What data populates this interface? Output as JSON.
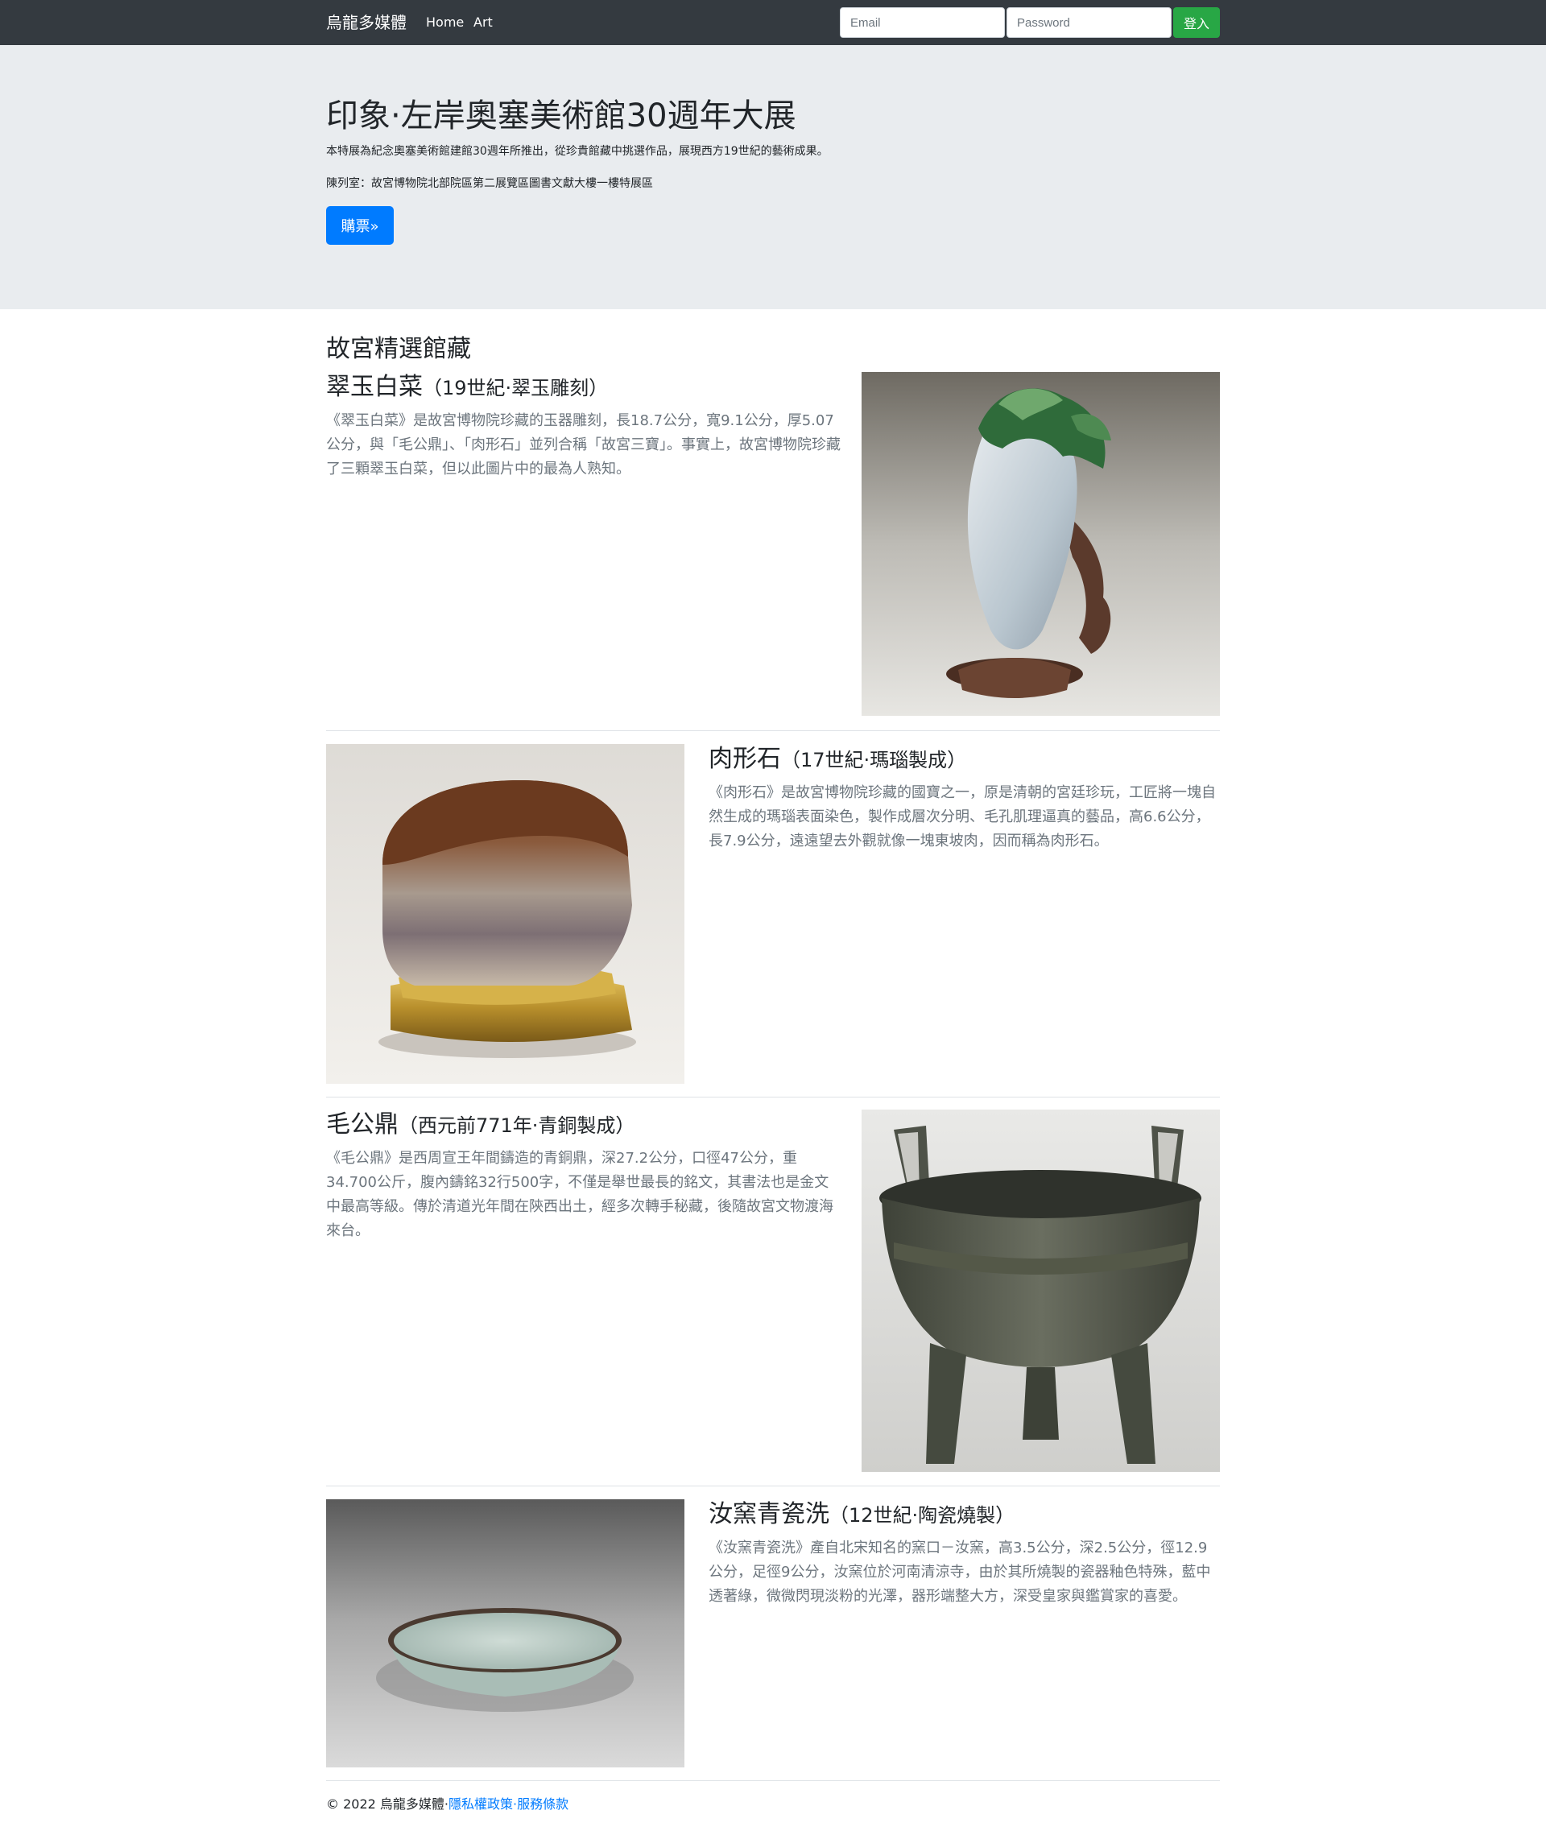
{
  "navbar": {
    "brand": "烏龍多媒體",
    "links": [
      "Home",
      "Art"
    ],
    "email_placeholder": "Email",
    "password_placeholder": "Password",
    "login_label": "登入"
  },
  "hero": {
    "title": "印象·左岸奧塞美術館30週年大展",
    "lead": "本特展為紀念奧塞美術館建館30週年所推出，從珍貴館藏中挑選作品，展現西方19世紀的藝術成果。",
    "location": "陳列室：故宮博物院北部院區第二展覽區圖書文獻大樓一樓特展區",
    "button_label": "購票»"
  },
  "section_title": "故宮精選館藏",
  "items": [
    {
      "name": "翠玉白菜",
      "sub": "（19世紀·翠玉雕刻）",
      "desc": "《翠玉白菜》是故宮博物院珍藏的玉器雕刻，長18.7公分，寬9.1公分，厚5.07公分，與「毛公鼎」、「肉形石」並列合稱「故宮三寶」。事實上，故宮博物院珍藏了三顆翠玉白菜，但以此圖片中的最為人熟知。"
    },
    {
      "name": "肉形石",
      "sub": "（17世紀·瑪瑙製成）",
      "desc": "《肉形石》是故宮博物院珍藏的國寶之一，原是清朝的宮廷珍玩，工匠將一塊自然生成的瑪瑙表面染色，製作成層次分明、毛孔肌理逼真的藝品，高6.6公分，長7.9公分，遠遠望去外觀就像一塊東坡肉，因而稱為肉形石。"
    },
    {
      "name": "毛公鼎",
      "sub": "（西元前771年·青銅製成）",
      "desc": "《毛公鼎》是西周宣王年間鑄造的青銅鼎，深27.2公分，口徑47公分，重34.700公斤，腹內鑄銘32行500字，不僅是舉世最長的銘文，其書法也是金文中最高等級。傳於清道光年間在陝西出土，經多次轉手秘藏，後隨故宮文物渡海來台。"
    },
    {
      "name": "汝窯青瓷洗",
      "sub": "（12世紀·陶瓷燒製）",
      "desc": "《汝窯青瓷洗》產自北宋知名的窯口－汝窯，高3.5公分，深2.5公分，徑12.9公分，足徑9公分，汝窯位於河南清涼寺，由於其所燒製的瓷器釉色特殊，藍中透著綠，微微閃現淡粉的光澤，器形端整大方，深受皇家與鑑賞家的喜愛。"
    }
  ],
  "footer": {
    "copyright": "© 2022 烏龍多媒體·",
    "privacy": "隱私權政策",
    "separator": "·",
    "terms": "服務條款"
  }
}
